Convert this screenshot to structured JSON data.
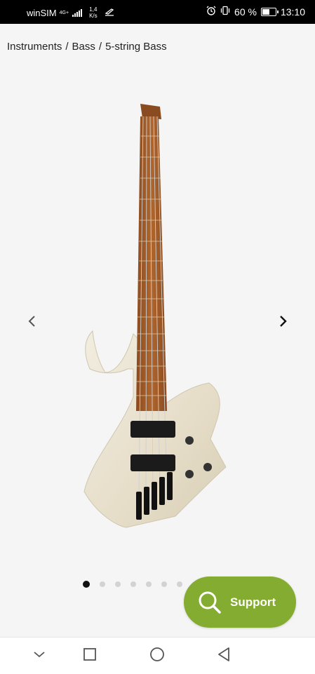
{
  "status_bar": {
    "carrier": "winSIM",
    "network_gen": "4G+",
    "speed_value": "1,4",
    "speed_unit": "K/s",
    "battery_percent": "60 %",
    "battery_level": 0.6,
    "time": "13:10",
    "icons": [
      "signal-icon",
      "airplane-data-icon",
      "alarm-icon",
      "vibrate-icon",
      "battery-icon"
    ]
  },
  "breadcrumb": {
    "items": [
      "Instruments",
      "Bass",
      "5-string Bass"
    ],
    "separator": "/"
  },
  "gallery": {
    "image_alt_icon": "headless-5-string-bass-guitar",
    "prev_icon": "chevron-left-icon",
    "next_icon": "chevron-right-icon",
    "dot_count": 7,
    "active_index": 0
  },
  "support_button": {
    "label": "Support",
    "icon": "search-icon",
    "color": "#84ac30"
  },
  "nav_bar": {
    "icons": [
      "chevron-down-icon",
      "recents-square-icon",
      "home-circle-icon",
      "back-triangle-icon"
    ]
  }
}
